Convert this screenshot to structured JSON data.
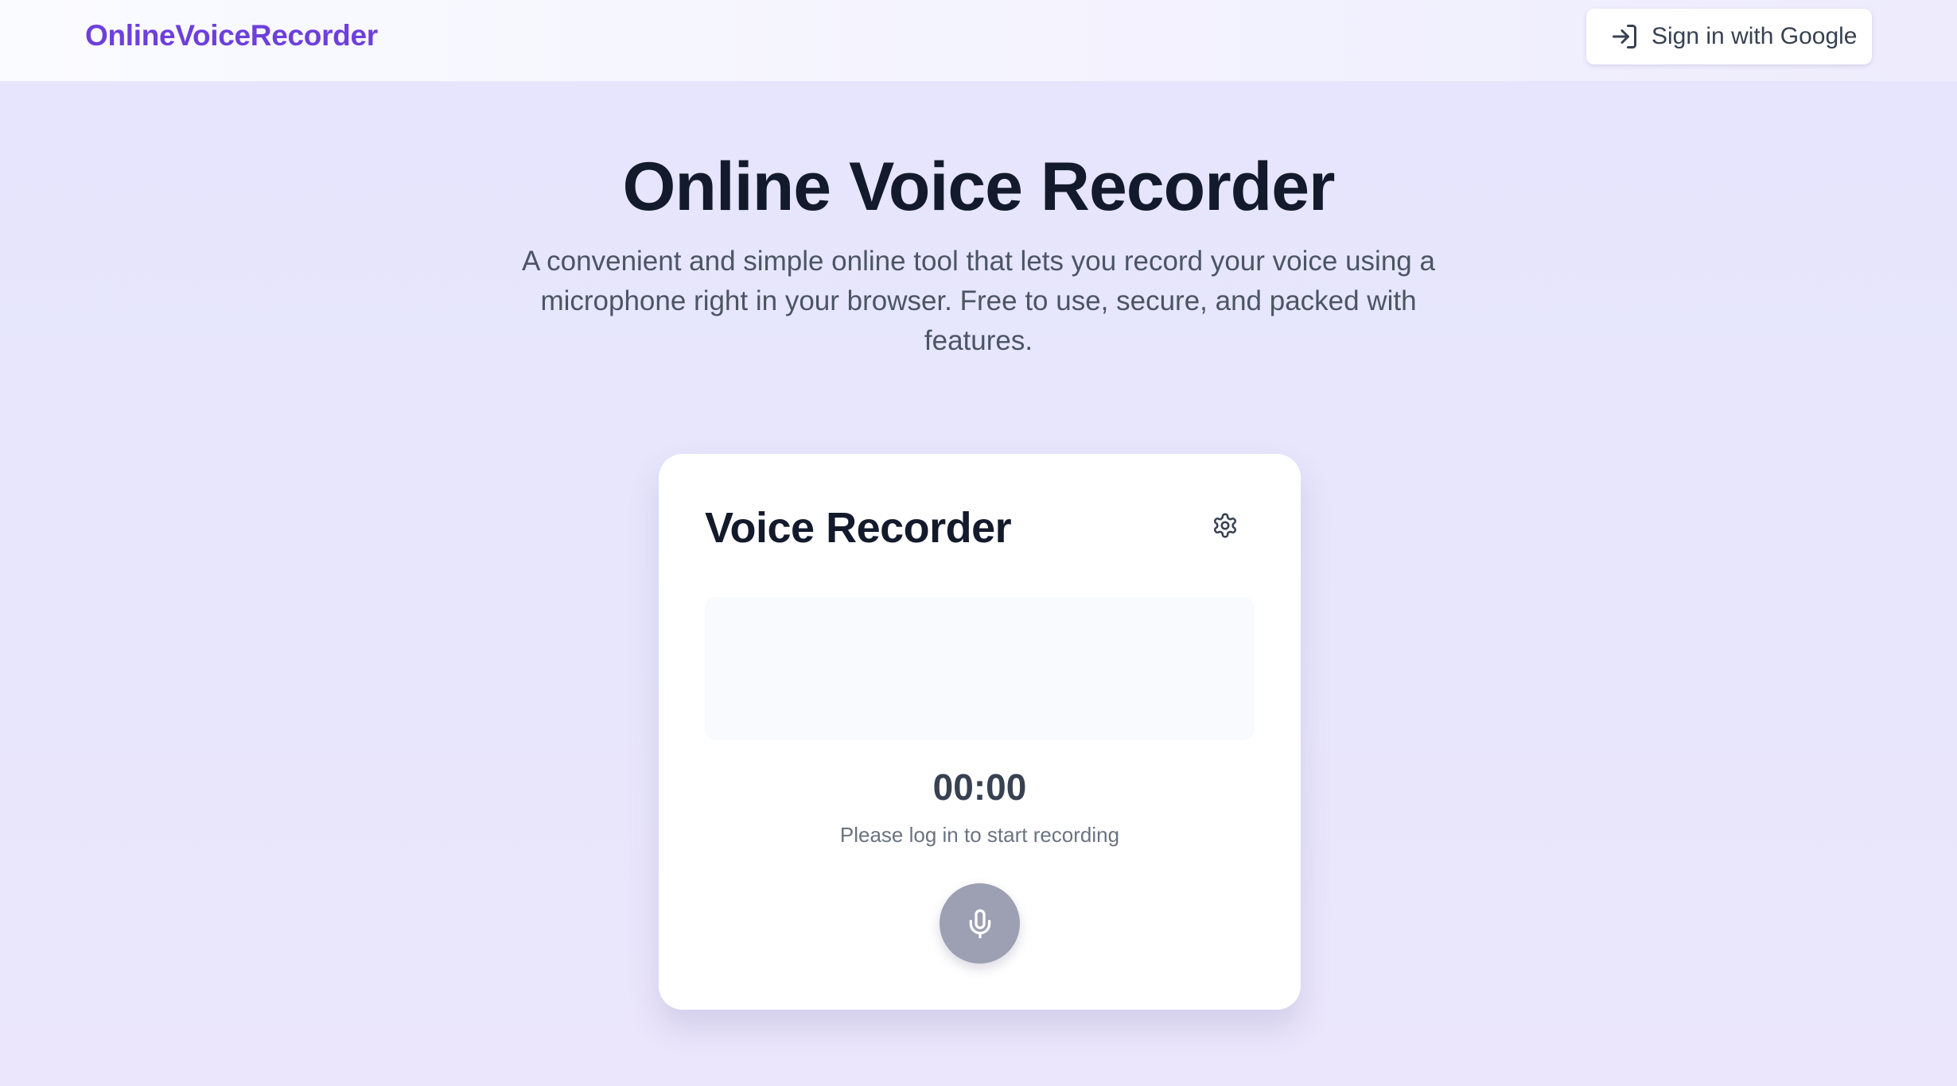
{
  "navbar": {
    "logo": "OnlineVoiceRecorder",
    "signin_label": "Sign in with Google",
    "signin_icon": "log-in-icon"
  },
  "hero": {
    "title": "Online Voice Recorder",
    "subtitle": "A convenient and simple online tool that lets you record your voice using a microphone right in your browser. Free to use, secure, and packed with features."
  },
  "recorder": {
    "title": "Voice Recorder",
    "settings_icon": "gear-icon",
    "timer": "00:00",
    "status": "Please log in to start recording",
    "mic_icon": "microphone-icon"
  },
  "colors": {
    "brand": "#6d3fdc",
    "title": "#131a2c",
    "mic_button": "#9d9fb3"
  }
}
